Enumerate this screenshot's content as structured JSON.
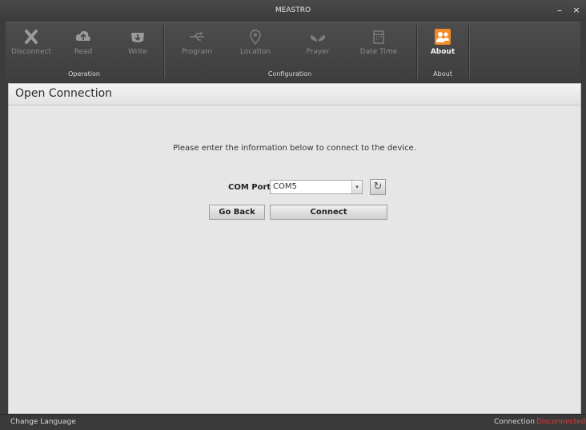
{
  "window": {
    "title": "MEASTRO",
    "minimize": "–",
    "close": "×"
  },
  "ribbon": {
    "operation": {
      "label": "Operation",
      "buttons": [
        {
          "label": "Disconnect",
          "icon": "close-x-icon"
        },
        {
          "label": "Read",
          "icon": "cloud-upload-icon"
        },
        {
          "label": "Write",
          "icon": "download-icon"
        }
      ]
    },
    "configuration": {
      "label": "Configuration",
      "buttons": [
        {
          "label": "Program",
          "icon": "usb-icon"
        },
        {
          "label": "Location",
          "icon": "map-pin-icon"
        },
        {
          "label": "Prayer",
          "icon": "hands-icon"
        },
        {
          "label": "Date Time",
          "icon": "calendar-icon"
        }
      ]
    },
    "about": {
      "label": "About",
      "buttons": [
        {
          "label": "About",
          "icon": "people-icon",
          "accent": "#f28c28"
        }
      ]
    }
  },
  "panel": {
    "title": "Open Connection",
    "instruction": "Please enter the information below to connect to the device.",
    "com_port_label": "COM Port",
    "com_port_value": "COM5",
    "go_back": "Go Back",
    "connect": "Connect"
  },
  "statusbar": {
    "change_language": "Change Language",
    "connection_label": "Connection",
    "connection_state": "Disconnected",
    "state_color": "#e23a3a"
  }
}
